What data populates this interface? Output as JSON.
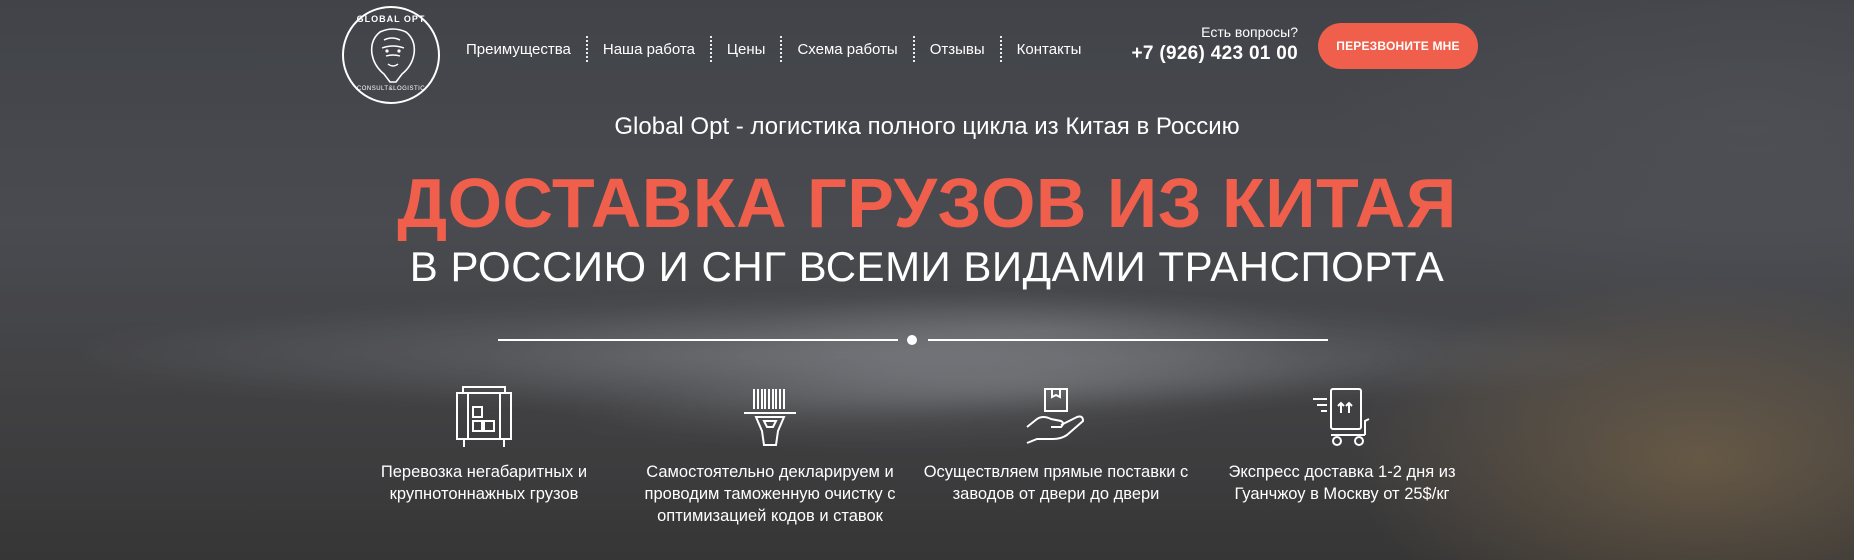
{
  "logo": {
    "top_text": "GLOBAL OPT",
    "bottom_text": "CONSULT&LOGISTIC",
    "icon": "lion-head-icon"
  },
  "nav": {
    "items": [
      {
        "label": "Преимущества"
      },
      {
        "label": "Наша работа"
      },
      {
        "label": "Цены"
      },
      {
        "label": "Схема работы"
      },
      {
        "label": "Отзывы"
      },
      {
        "label": "Контакты"
      }
    ]
  },
  "contact": {
    "question": "Есть вопросы?",
    "phone": "+7 (926) 423 01 00"
  },
  "callback_button": "ПЕРЕЗВОНИТЕ МНЕ",
  "hero": {
    "subtitle": "Global Opt - логистика полного цикла из Китая в Россию",
    "headline": "ДОСТАВКА ГРУЗОВ ИЗ КИТАЯ",
    "headline2": "В РОССИЮ И СНГ ВСЕМИ ВИДАМИ ТРАНСПОРТА"
  },
  "features": [
    {
      "icon": "container-icon",
      "text": "Перевозка негабаритных и крупнотоннажных грузов"
    },
    {
      "icon": "barcode-scanner-icon",
      "text": "Самостоятельно декларируем и проводим таможенную очистку с оптимизацией кодов и ставок"
    },
    {
      "icon": "hand-box-icon",
      "text": "Осуществляем прямые поставки с заводов от двери до двери"
    },
    {
      "icon": "express-cart-icon",
      "text": "Экспресс доставка 1-2 дня из Гуанчжоу в Москву от 25$/кг"
    }
  ],
  "colors": {
    "accent": "#ef5f4b",
    "text": "#ffffff"
  }
}
